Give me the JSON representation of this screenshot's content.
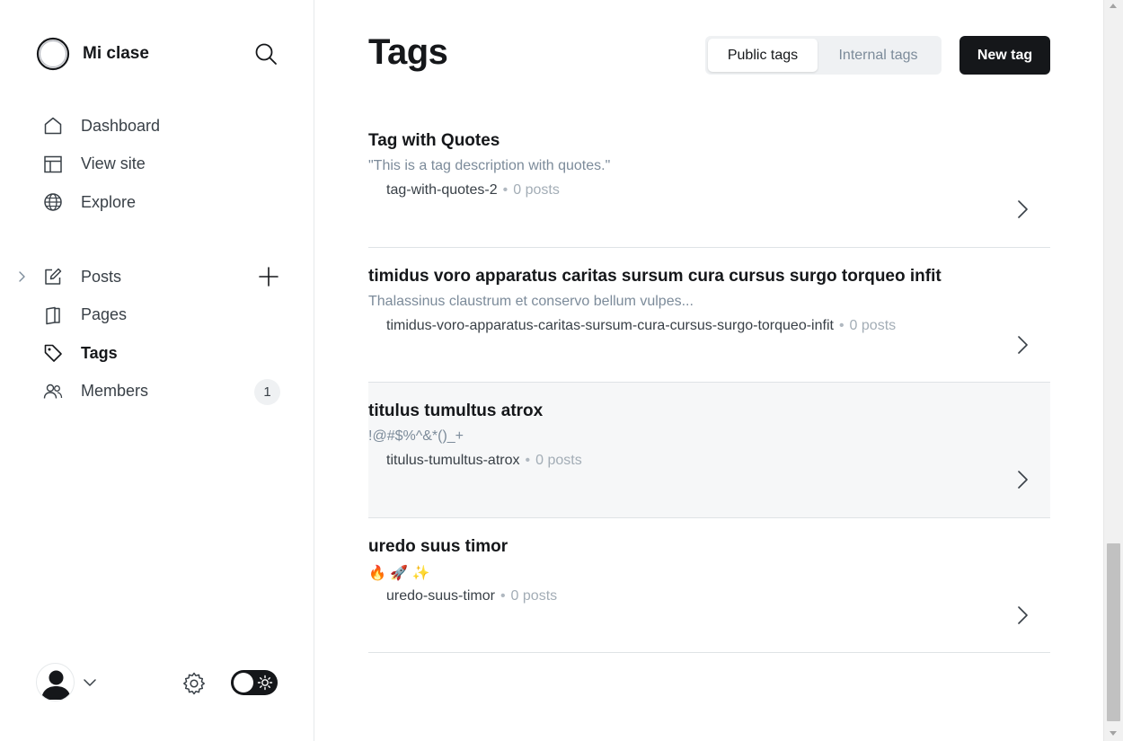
{
  "sidebar": {
    "brand_name": "Mi clase",
    "nav_top": [
      {
        "label": "Dashboard",
        "icon": "home-icon"
      },
      {
        "label": "View site",
        "icon": "layout-icon"
      },
      {
        "label": "Explore",
        "icon": "globe-icon"
      }
    ],
    "nav_main": [
      {
        "label": "Posts",
        "icon": "pen-square-icon"
      },
      {
        "label": "Pages",
        "icon": "page-icon"
      },
      {
        "label": "Tags",
        "icon": "tag-icon",
        "active": true
      },
      {
        "label": "Members",
        "icon": "members-icon",
        "count": "1"
      }
    ]
  },
  "header": {
    "title": "Tags",
    "tab_public": "Public tags",
    "tab_internal": "Internal tags",
    "new_tag": "New tag"
  },
  "tags": [
    {
      "name": "Tag with Quotes",
      "description": "\"This is a tag description with quotes.\"",
      "slug": "tag-with-quotes-2",
      "separator": "•",
      "posts": "0 posts"
    },
    {
      "name": "timidus voro apparatus caritas sursum cura cursus surgo torqueo infit",
      "description": "Thalassinus claustrum et conservo bellum vulpes...",
      "slug": "timidus-voro-apparatus-caritas-sursum-cura-cursus-surgo-torqueo-infit",
      "separator": "•",
      "posts": "0 posts"
    },
    {
      "name": "titulus tumultus atrox",
      "description": "!@#$%^&*()_+",
      "slug": "titulus-tumultus-atrox",
      "separator": "•",
      "posts": "0 posts"
    },
    {
      "name": "uredo suus timor",
      "description": "🔥 🚀 ✨",
      "slug": "uredo-suus-timor",
      "separator": "•",
      "posts": "0 posts"
    }
  ],
  "colors": {
    "accent": "#15171a",
    "muted_text": "#7c8b9a",
    "row_hover": "#f6f7f8"
  }
}
